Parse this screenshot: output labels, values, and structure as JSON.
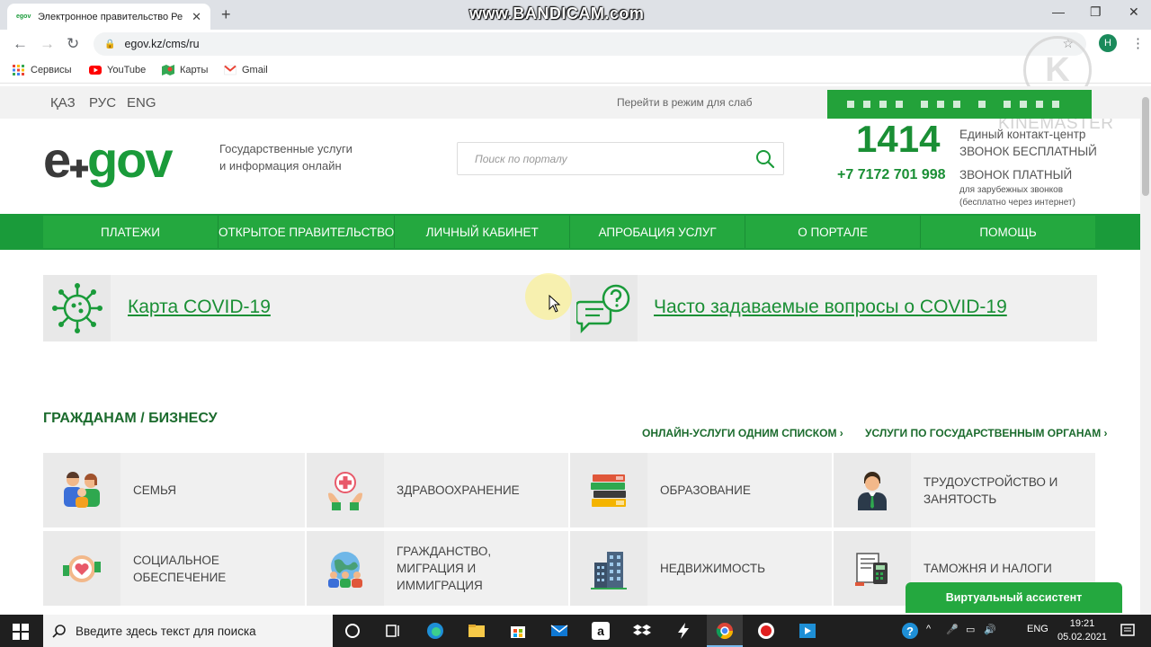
{
  "browser": {
    "tab_title": "Электронное правительство Ре",
    "tab_favicon": "egov",
    "url": "egov.kz/cms/ru",
    "profile_initial": "H",
    "bookmarks": [
      "Сервисы",
      "YouTube",
      "Карты",
      "Gmail"
    ]
  },
  "watermarks": {
    "bandicam": "www.BANDICAM.com",
    "kinemaster": "KINEMASTER",
    "kinemaster_letter": "K"
  },
  "topbar": {
    "languages": [
      "ҚАЗ",
      "РУС",
      "ENG"
    ],
    "low_vision": "Перейти в режим для слаб"
  },
  "header": {
    "logo_e": "e",
    "logo_gov": "gov",
    "tagline": [
      "Государственные услуги",
      "и информация онлайн"
    ],
    "search_placeholder": "Поиск по порталу",
    "phone_short": "1414",
    "contact_label": [
      "Единый контакт-центр",
      "ЗВОНОК БЕСПЛАТНЫЙ"
    ],
    "phone_long": "+7 7172 701 998",
    "paid_label": "ЗВОНОК ПЛАТНЫЙ",
    "paid_sub": [
      "для зарубежных звонков",
      "(бесплатно через интернет)"
    ]
  },
  "nav": [
    "ПЛАТЕЖИ",
    "ОТКРЫТОЕ ПРАВИТЕЛЬСТВО",
    "ЛИЧНЫЙ КАБИНЕТ",
    "АПРОБАЦИЯ УСЛУГ",
    "О ПОРТАЛЕ",
    "ПОМОЩЬ"
  ],
  "covid": {
    "map": "Карта COVID-19",
    "faq": "Часто задаваемые вопросы о COVID-19"
  },
  "services": {
    "title": "ГРАЖДАНАМ / БИЗНЕСУ",
    "link_list": "ОНЛАЙН-УСЛУГИ ОДНИМ СПИСКОМ ›",
    "link_agencies": "УСЛУГИ ПО ГОСУДАРСТВЕННЫМ ОРГАНАМ ›",
    "tiles": [
      {
        "label": [
          "СЕМЬЯ"
        ],
        "icon": "family-icon"
      },
      {
        "label": [
          "ЗДРАВООХРАНЕНИЕ"
        ],
        "icon": "healthcare-icon"
      },
      {
        "label": [
          "ОБРАЗОВАНИЕ"
        ],
        "icon": "books-icon"
      },
      {
        "label": [
          "ТРУДОУСТРОЙСТВО И",
          "ЗАНЯТОСТЬ"
        ],
        "icon": "employee-icon"
      },
      {
        "label": [
          "СОЦИАЛЬНОЕ",
          "ОБЕСПЕЧЕНИЕ"
        ],
        "icon": "social-care-icon"
      },
      {
        "label": [
          "ГРАЖДАНСТВО,",
          "МИГРАЦИЯ И",
          "ИММИГРАЦИЯ"
        ],
        "icon": "globe-people-icon"
      },
      {
        "label": [
          "НЕДВИЖИМОСТЬ"
        ],
        "icon": "buildings-icon"
      },
      {
        "label": [
          "ТАМОЖНЯ И НАЛОГИ"
        ],
        "icon": "tax-documents-icon"
      }
    ]
  },
  "assistant": "Виртуальный ассистент",
  "taskbar": {
    "search_placeholder": "Введите здесь текст для поиска",
    "lang": "ENG",
    "time": "19:21",
    "date": "05.02.2021"
  },
  "colors": {
    "brand_green": "#1a9b3a",
    "nav_green": "#24a83f",
    "title_green": "#1b6b2d"
  }
}
